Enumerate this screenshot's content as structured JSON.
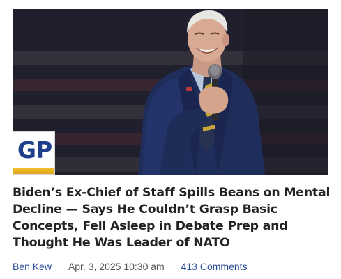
{
  "article": {
    "headline": "Biden’s Ex-Chief of Staff Spills Beans on Mental Decline — Says He Couldn’t Grasp Basic Concepts, Fell Asleep in Debate Prep and Thought He Was Leader of NATO",
    "author": "Ben Kew",
    "date": "Apr. 3, 2025 10:30 am",
    "comments": "413 Comments"
  },
  "logo": {
    "text": "GP"
  },
  "image": {
    "icon": "photo-of-man-speaking-into-microphone"
  },
  "colors": {
    "link": "#2d4e9a",
    "logo_blue": "#1f3f8c",
    "logo_gold": "#e7b222",
    "headline": "#222222"
  }
}
